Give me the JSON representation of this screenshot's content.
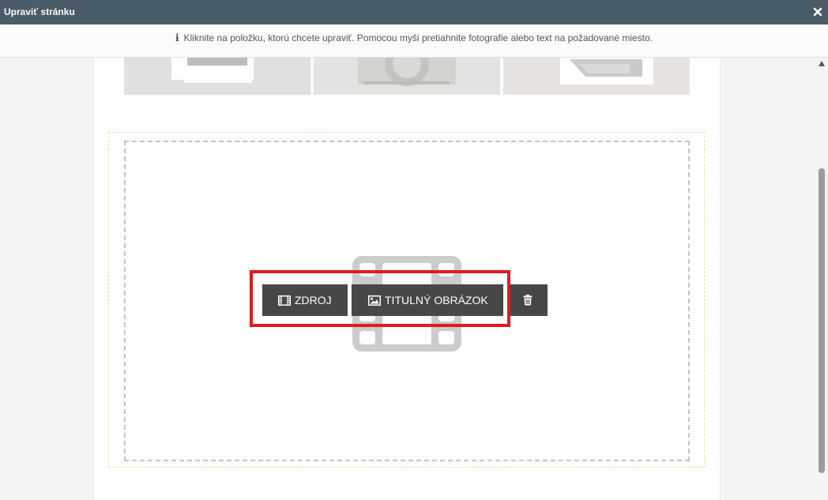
{
  "titlebar": {
    "title": "Upraviť stránku",
    "close_icon": "close-icon"
  },
  "infobar": {
    "icon": "info-icon",
    "message": "Kliknite na položku, ktorú chcete upraviť. Pomocou myši pretiahnite fotografie alebo text na požadované miesto."
  },
  "gallery": {
    "thumbnails": [
      "gallery-thumbnail-1",
      "gallery-thumbnail-2",
      "gallery-thumbnail-3"
    ]
  },
  "video_block": {
    "placeholder_icon": "film-icon",
    "toolbar": {
      "source_label": "ZDROJ",
      "cover_image_label": "TITULNÝ OBRÁZOK",
      "delete_icon": "trash-icon"
    }
  },
  "colors": {
    "titlebar_bg": "#485b66",
    "button_bg": "#474747",
    "highlight": "#e01b1b"
  }
}
